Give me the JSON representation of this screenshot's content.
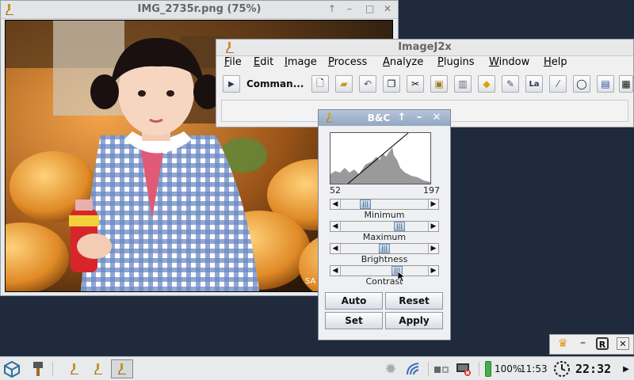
{
  "image_window": {
    "title": "IMG_2735r.png (75%)",
    "controls": [
      "↑",
      "–",
      "□",
      "✕"
    ],
    "watermark": "SA"
  },
  "imagej": {
    "title": "ImageJ2x",
    "menu": [
      "File",
      "Edit",
      "Image",
      "Process",
      "Analyze",
      "Plugins",
      "Window",
      "Help"
    ],
    "command_label": "Comman...",
    "toolbar_icons": [
      "new-icon",
      "open-icon",
      "revert-icon",
      "copy-icon",
      "cut-icon",
      "paste-icon",
      "delete-icon",
      "fill-icon",
      "pencil-icon",
      "label-icon",
      "wand-icon",
      "circle-icon",
      "file-icon",
      "text-file-icon"
    ],
    "label_button": "La"
  },
  "bc_dialog": {
    "title": "B&C",
    "min_value": "52",
    "max_value": "197",
    "sliders": [
      {
        "label": "Minimum",
        "position": 0.25
      },
      {
        "label": "Maximum",
        "position": 0.7
      },
      {
        "label": "Brightness",
        "position": 0.5
      },
      {
        "label": "Contrast",
        "position": 0.67
      }
    ],
    "buttons": {
      "auto": "Auto",
      "reset": "Reset",
      "set": "Set",
      "apply": "Apply"
    }
  },
  "taskbar": {
    "battery": "100%",
    "battery_time": "11:53",
    "clock": "22:32"
  },
  "colors": {
    "desktop": "#1f2a3d",
    "bc_title": "#9aadc6",
    "accent_green": "#3fb24a"
  }
}
